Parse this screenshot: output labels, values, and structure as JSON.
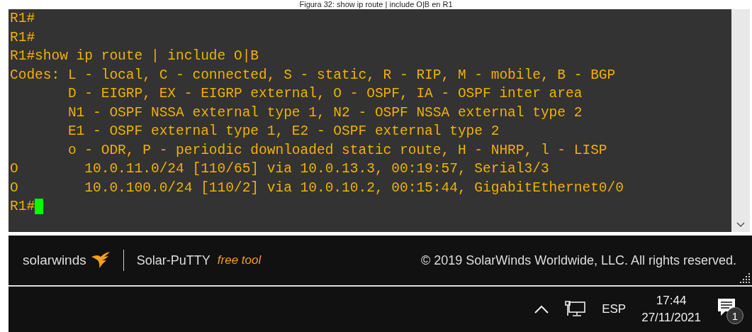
{
  "caption": "Figura 32: show ip route | include O|B en R1",
  "terminal": {
    "lines": [
      "R1#",
      "R1#",
      "R1#show ip route | include O|B",
      "Codes: L - local, C - connected, S - static, R - RIP, M - mobile, B - BGP",
      "       D - EIGRP, EX - EIGRP external, O - OSPF, IA - OSPF inter area",
      "       N1 - OSPF NSSA external type 1, N2 - OSPF NSSA external type 2",
      "       E1 - OSPF external type 1, E2 - OSPF external type 2",
      "       o - ODR, P - periodic downloaded static route, H - NHRP, l - LISP",
      "O        10.0.11.0/24 [110/65] via 10.0.13.3, 00:19:57, Serial3/3",
      "O        10.0.100.0/24 [110/2] via 10.0.10.2, 00:15:44, GigabitEthernet0/0"
    ],
    "prompt": "R1#"
  },
  "footer": {
    "brand": "solarwinds",
    "product": "Solar-PuTTY",
    "tag": "free tool",
    "copyright": "© 2019 SolarWinds Worldwide, LLC. All rights reserved."
  },
  "taskbar": {
    "language": "ESP",
    "time": "17:44",
    "date": "27/11/2021",
    "notifications": "1"
  }
}
